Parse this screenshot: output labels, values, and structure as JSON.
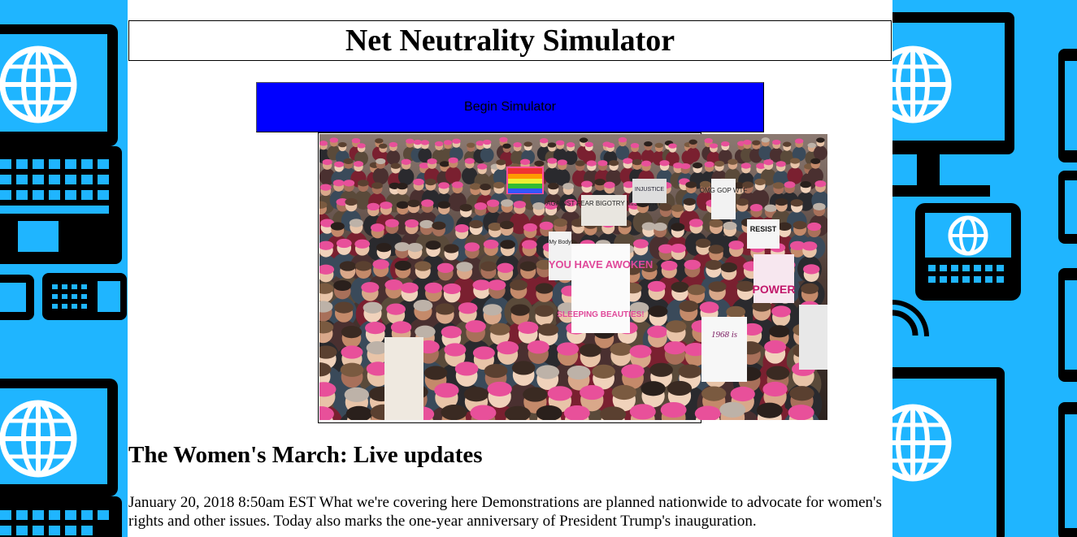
{
  "page": {
    "title": "Net Neutrality Simulator",
    "begin_button_label": "Begin Simulator"
  },
  "background": {
    "color": "#1fb5ff",
    "icons": [
      "laptop-globe-icon",
      "keyboard-icon",
      "monitor-globe-icon",
      "tablet-globe-icon",
      "phone-icon"
    ]
  },
  "article": {
    "image": {
      "description_icon": "protest-crowd-photo",
      "sign_texts": [
        "YOU HAVE AWOKEN",
        "SLEEPING BEAUTIES!",
        "AGAINST FEAR BIGOTRY MISOGYNY",
        "OMG GOP WTF",
        "RESIST",
        "INJUSTICE",
        "POWER",
        "1968 is",
        "My Body"
      ]
    },
    "headline": "The Women's March: Live updates",
    "body": "January 20, 2018 8:50am EST What we're covering here Demonstrations are planned nationwide to advocate for women's rights and other issues. Today also marks the one-year anniversary of President Trump's inauguration."
  },
  "colors": {
    "button": "#0000ff",
    "page": "#ffffff",
    "accent_pink": "#e8509a"
  }
}
